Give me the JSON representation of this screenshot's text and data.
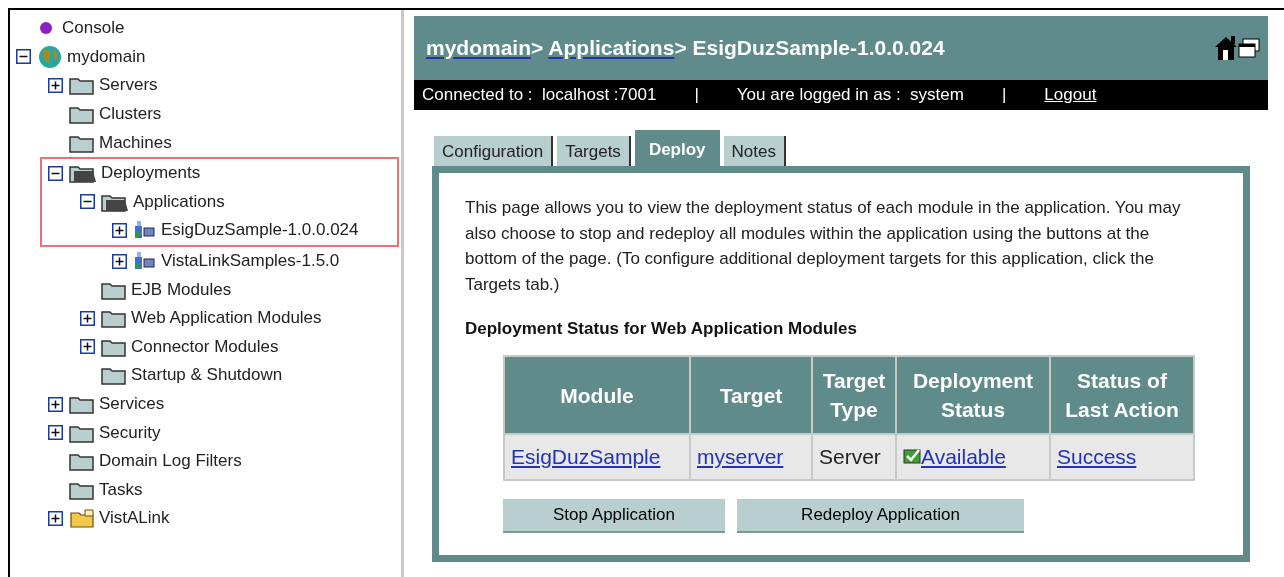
{
  "tree": [
    {
      "label": "Console",
      "kind": "orb",
      "highlighted": false
    },
    {
      "label": "mydomain",
      "kind": "globe",
      "expanded": true,
      "highlighted": false,
      "children": [
        {
          "label": "Servers",
          "kind": "folder",
          "expanded": false,
          "highlighted": false
        },
        {
          "label": "Clusters",
          "kind": "folder",
          "highlighted": false
        },
        {
          "label": "Machines",
          "kind": "folder",
          "highlighted": false
        },
        {
          "label": "Deployments",
          "kind": "open-folder",
          "expanded": true,
          "highlighted": true,
          "children": [
            {
              "label": "Applications",
              "kind": "open-folder",
              "expanded": true,
              "highlighted": true,
              "children": [
                {
                  "label": "EsigDuzSample-1.0.0.024",
                  "kind": "app",
                  "expanded": false,
                  "highlighted": true
                },
                {
                  "label": "VistaLinkSamples-1.5.0",
                  "kind": "app",
                  "expanded": false,
                  "highlighted": false
                }
              ]
            },
            {
              "label": "EJB Modules",
              "kind": "folder",
              "highlighted": false
            },
            {
              "label": "Web Application Modules",
              "kind": "folder",
              "expanded": false,
              "highlighted": false
            },
            {
              "label": "Connector Modules",
              "kind": "folder",
              "expanded": false,
              "highlighted": false
            },
            {
              "label": "Startup & Shutdown",
              "kind": "folder",
              "highlighted": false
            }
          ]
        },
        {
          "label": "Services",
          "kind": "folder",
          "expanded": false,
          "highlighted": false
        },
        {
          "label": "Security",
          "kind": "folder",
          "expanded": false,
          "highlighted": false
        },
        {
          "label": "Domain Log Filters",
          "kind": "folder",
          "highlighted": false
        },
        {
          "label": "Tasks",
          "kind": "folder",
          "highlighted": false
        },
        {
          "label": "VistALink",
          "kind": "yellow-folder",
          "expanded": false,
          "highlighted": false
        }
      ]
    }
  ],
  "breadcrumb": [
    {
      "label": "mydomain",
      "link": true
    },
    {
      "label": "> ",
      "link": false
    },
    {
      "label": "Applications",
      "link": true
    },
    {
      "label": "> EsigDuzSample-1.0.0.024",
      "link": false
    }
  ],
  "status_bar": {
    "connected": "Connected to :  localhost :7001",
    "separator_1": "|",
    "user": "You are logged in as :  system",
    "separator_2": "|",
    "logout": "Logout"
  },
  "tabs": [
    {
      "label": "Configuration",
      "selected": false
    },
    {
      "label": "Targets",
      "selected": false
    },
    {
      "label": "Deploy",
      "selected": true
    },
    {
      "label": "Notes",
      "selected": false
    }
  ],
  "description": "This page allows you to view the deployment status of each module in the application. You may also choose to stop and redeploy all modules within the application using the buttons at the bottom of the page. (To configure additional deployment targets for this application, click the Targets tab.)",
  "section_title": "Deployment Status for Web Application Modules",
  "table": {
    "columns": [
      "Module",
      "Target",
      "Target Type",
      "Deployment Status",
      "Status of Last Action"
    ],
    "rows": [
      [
        {
          "text": "EsigDuzSample",
          "link": true
        },
        {
          "text": "myserver",
          "link": true
        },
        {
          "text": "Server",
          "link": false
        },
        {
          "text": "Available",
          "link": true,
          "checked": true
        },
        {
          "text": "Success",
          "link": true
        }
      ]
    ]
  },
  "buttons": [
    "Stop Application",
    "Redeploy Application"
  ]
}
